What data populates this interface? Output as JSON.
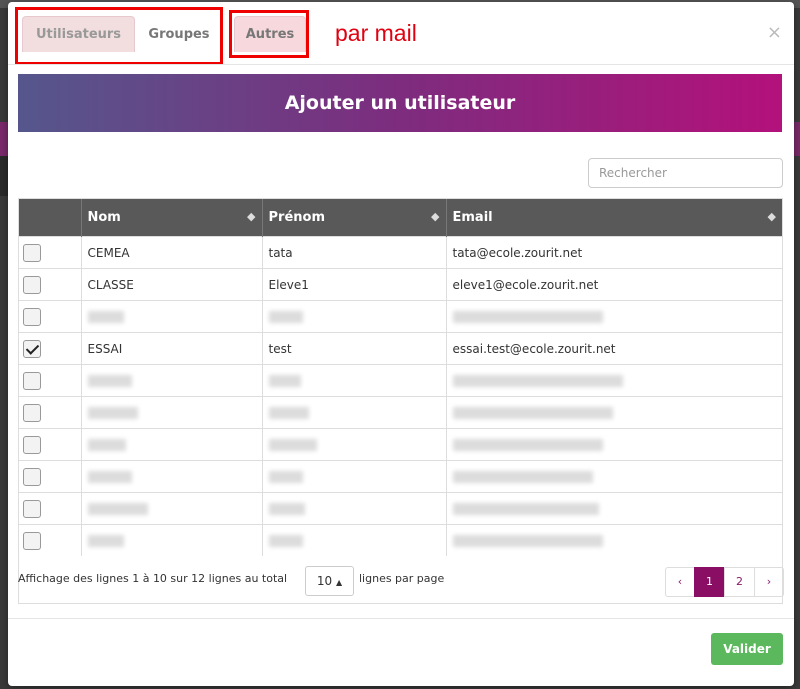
{
  "tabs": {
    "users": "Utilisateurs",
    "groups": "Groupes",
    "others": "Autres"
  },
  "annotation": "par mail",
  "close": "×",
  "add_user_button": "Ajouter un utilisateur",
  "search": {
    "placeholder": "Rechercher",
    "value": ""
  },
  "table": {
    "headers": [
      "Nom",
      "Prénom",
      "Email"
    ],
    "rows": [
      {
        "checked": false,
        "nom": "CEMEA",
        "prenom": "tata",
        "email": "tata@ecole.zourit.net"
      },
      {
        "checked": false,
        "nom": "CLASSE",
        "prenom": "Eleve1",
        "email": "eleve1@ecole.zourit.net"
      },
      {
        "checked": false,
        "nom": "",
        "prenom": "",
        "email": ""
      },
      {
        "checked": true,
        "nom": "ESSAI",
        "prenom": "test",
        "email": "essai.test@ecole.zourit.net"
      },
      {
        "checked": false,
        "nom": "",
        "prenom": "",
        "email": ""
      },
      {
        "checked": false,
        "nom": "",
        "prenom": "",
        "email": ""
      },
      {
        "checked": false,
        "nom": "",
        "prenom": "",
        "email": ""
      },
      {
        "checked": false,
        "nom": "",
        "prenom": "",
        "email": ""
      },
      {
        "checked": false,
        "nom": "",
        "prenom": "",
        "email": ""
      },
      {
        "checked": false,
        "nom": "",
        "prenom": "",
        "email": ""
      }
    ]
  },
  "footer": {
    "info": "Affichage des lignes 1 à 10 sur 12 lignes au total",
    "page_size": "10",
    "per_page_label": "lignes par page"
  },
  "pagination": {
    "prev": "‹",
    "pages": [
      "1",
      "2"
    ],
    "current": "1",
    "next": "›"
  },
  "submit_button": "Valider",
  "colors": {
    "accent": "#8a0f64",
    "success": "#5cb85c",
    "annotation": "#e00010"
  }
}
